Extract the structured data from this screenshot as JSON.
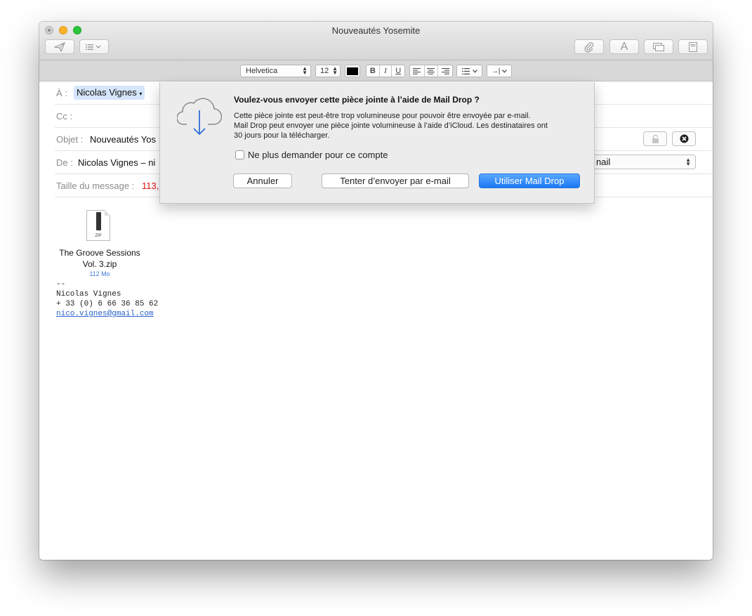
{
  "window": {
    "title": "Nouveautés Yosemite"
  },
  "toolbar": {
    "send_icon": "paper-plane-icon",
    "header_fields_icon": "list-options-icon",
    "attach_icon": "paperclip-icon",
    "format_icon": "font-A-icon",
    "photo_browser_icon": "photo-browser-icon",
    "stationery_icon": "stationery-icon"
  },
  "format_bar": {
    "font": "Helvetica",
    "size": "12",
    "color": "#000000",
    "bold": "B",
    "italic": "I",
    "underline": "U",
    "indent_label": "→|"
  },
  "headers": {
    "to_label": "À :",
    "to_recipient": "Nicolas Vignes",
    "cc_label": "Cc :",
    "subject_label": "Objet :",
    "subject_value": "Nouveautés Yos",
    "from_label": "De :",
    "from_value": "Nicolas Vignes – ni",
    "from_account_suffix": "nail",
    "size_label": "Taille du message :",
    "size_value": "113,"
  },
  "attachment": {
    "icon_label": "ZIP",
    "name_line1": "The Groove Sessions",
    "name_line2": "Vol. 3.zip",
    "size": "112 Mo"
  },
  "signature": {
    "dash": "--",
    "name": "Nicolas Vignes",
    "phone": "+ 33 (0) 6 66 36 85 62",
    "email": "nico.vignes@gmail.com"
  },
  "dialog": {
    "icon": "cloud-download-icon",
    "title": "Voulez-vous envoyer cette pièce jointe à l’aide de Mail Drop ?",
    "line1": "Cette pièce jointe est peut-être trop volumineuse pour pouvoir être envoyée par e-mail.",
    "line2": "Mail Drop peut envoyer une pièce jointe volumineuse à l’aide d’iCloud. Les destinataires ont",
    "line3": "30 jours pour la télécharger.",
    "checkbox_label": "Ne plus demander pour ce compte",
    "cancel_label": "Annuler",
    "try_label": "Tenter d’envoyer par e-mail",
    "use_label": "Utiliser Mail Drop",
    "accent_color": "#1a78f5"
  }
}
